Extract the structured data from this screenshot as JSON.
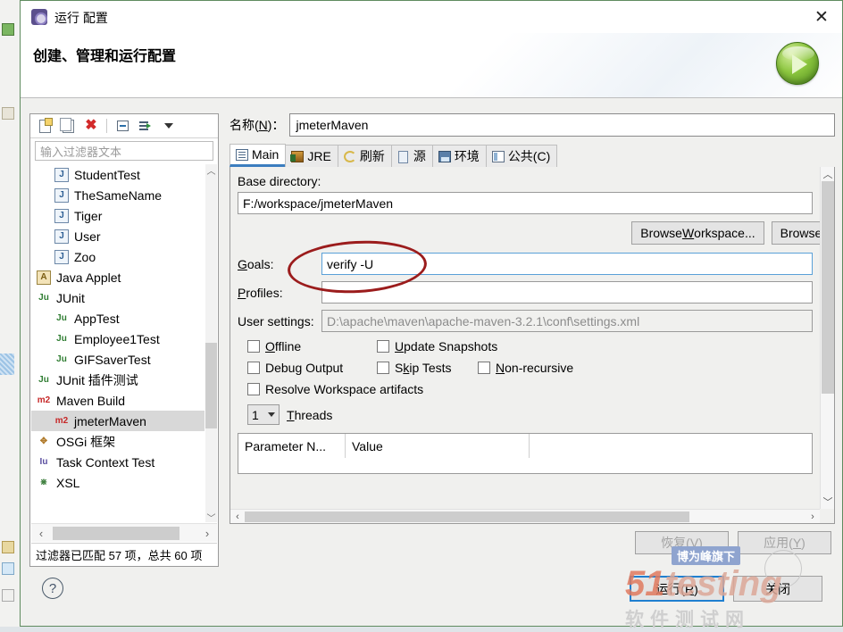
{
  "window": {
    "title": "运行 配置",
    "close_label": "✕",
    "heading": "创建、管理和运行配置",
    "run_icon": "green-play-icon"
  },
  "left_panel": {
    "toolbar": [
      {
        "name": "new-configuration-icon",
        "tooltip": "新建"
      },
      {
        "name": "duplicate-configuration-icon",
        "tooltip": "复制"
      },
      {
        "name": "delete-configuration-icon",
        "tooltip": "删除"
      },
      {
        "name": "collapse-all-icon",
        "tooltip": "全部折叠"
      },
      {
        "name": "filter-icon",
        "tooltip": "过滤"
      },
      {
        "name": "view-menu-caret-icon",
        "tooltip": "菜单"
      }
    ],
    "filter_placeholder": "输入过滤器文本",
    "filter_value": "",
    "tree": [
      {
        "label": "StudentTest",
        "icon": "java-application-icon",
        "indent": 1,
        "selected": false
      },
      {
        "label": "TheSameName",
        "icon": "java-application-icon",
        "indent": 1,
        "selected": false
      },
      {
        "label": "Tiger",
        "icon": "java-application-icon",
        "indent": 1,
        "selected": false
      },
      {
        "label": "User",
        "icon": "java-application-icon",
        "indent": 1,
        "selected": false
      },
      {
        "label": "Zoo",
        "icon": "java-application-icon",
        "indent": 1,
        "selected": false
      },
      {
        "label": "Java Applet",
        "icon": "java-applet-icon",
        "indent": 0,
        "selected": false
      },
      {
        "label": "JUnit",
        "icon": "junit-icon",
        "indent": 0,
        "selected": false
      },
      {
        "label": "AppTest",
        "icon": "junit-icon",
        "indent": 1,
        "selected": false
      },
      {
        "label": "Employee1Test",
        "icon": "junit-icon",
        "indent": 1,
        "selected": false
      },
      {
        "label": "GIFSaverTest",
        "icon": "junit-icon",
        "indent": 1,
        "selected": false
      },
      {
        "label": "JUnit 插件测试",
        "icon": "junit-plugin-icon",
        "indent": 0,
        "selected": false
      },
      {
        "label": "Maven Build",
        "icon": "maven-icon",
        "indent": 0,
        "selected": false
      },
      {
        "label": "jmeterMaven",
        "icon": "maven-icon",
        "indent": 1,
        "selected": true
      },
      {
        "label": "OSGi 框架",
        "icon": "osgi-icon",
        "indent": 0,
        "selected": false
      },
      {
        "label": "Task Context Test",
        "icon": "task-context-icon",
        "indent": 0,
        "selected": false
      },
      {
        "label": "XSL",
        "icon": "xsl-icon",
        "indent": 0,
        "selected": false
      }
    ],
    "status": "过滤器已匹配 57 项，总共 60 项"
  },
  "config": {
    "name_label": "名称(N)：",
    "name_value": "jmeterMaven",
    "tabs": [
      {
        "label": "Main",
        "icon": "main-tab-icon",
        "active": true
      },
      {
        "label": "JRE",
        "icon": "jre-tab-icon",
        "active": false
      },
      {
        "label": "刷新",
        "icon": "refresh-tab-icon",
        "active": false
      },
      {
        "label": "源",
        "icon": "source-tab-icon",
        "active": false
      },
      {
        "label": "环境",
        "icon": "environment-tab-icon",
        "active": false
      },
      {
        "label": "公共(C)",
        "icon": "common-tab-icon",
        "active": false
      }
    ],
    "base_directory_label": "Base directory:",
    "base_directory_value": "F:/workspace/jmeterMaven",
    "browse_workspace_label": "Browse Workspace...",
    "browse_filesystem_label": "Browse File S",
    "goals_label": "Goals:",
    "goals_value": "verify -U",
    "profiles_label": "Profiles:",
    "profiles_value": "",
    "user_settings_label": "User settings:",
    "user_settings_placeholder": "D:\\apache\\maven\\apache-maven-3.2.1\\conf\\settings.xml",
    "checkboxes": [
      {
        "label": "Offline",
        "checked": false
      },
      {
        "label": "Update Snapshots",
        "checked": false
      },
      {
        "label": "Debug Output",
        "checked": false
      },
      {
        "label": "Skip Tests",
        "checked": false
      },
      {
        "label": "Non-recursive",
        "checked": false
      },
      {
        "label": "Resolve Workspace artifacts",
        "checked": false
      }
    ],
    "threads_value": "1",
    "threads_label": "Threads",
    "parameters_table": {
      "columns": [
        "Parameter N...",
        "Value",
        ""
      ],
      "rows": []
    },
    "revert_label": "恢复(V)",
    "apply_label": "应用(Y)"
  },
  "footer": {
    "help_icon": "?",
    "run_label": "运行(R)",
    "close_label": "关闭"
  },
  "watermark": {
    "badge": "博为峰旗下",
    "brand_51": "51",
    "brand_testing": "testing",
    "brand_cn": "软件测试网"
  },
  "colors": {
    "accent_blue": "#1f7fd0",
    "annotation_red": "#9b1c1c",
    "selection_gray": "#d8d8d8",
    "play_green": "#8cc63f"
  }
}
